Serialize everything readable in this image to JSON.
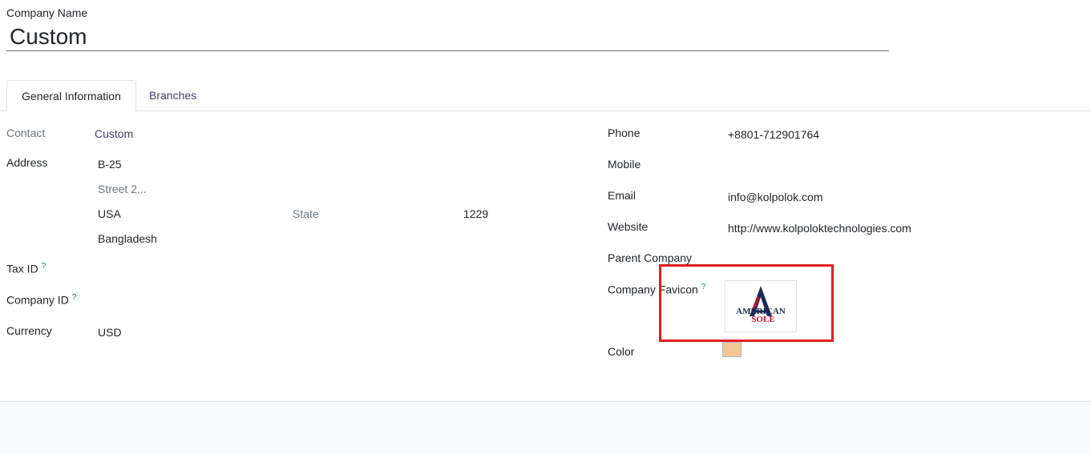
{
  "form": {
    "company_name_label": "Company Name",
    "company_name_value": "Custom"
  },
  "tabs": [
    {
      "label": "General Information",
      "active": true
    },
    {
      "label": "Branches",
      "active": false
    }
  ],
  "left": {
    "contact_label": "Contact",
    "contact_value": "Custom",
    "address_label": "Address",
    "street": "B-25",
    "street2_placeholder": "Street 2...",
    "city": "USA",
    "state_placeholder": "State",
    "zip": "1229",
    "country": "Bangladesh",
    "tax_id_label": "Tax ID",
    "company_id_label": "Company ID",
    "currency_label": "Currency",
    "currency_value": "USD",
    "help_mark": "?"
  },
  "right": {
    "phone_label": "Phone",
    "phone_value": "+8801-712901764",
    "mobile_label": "Mobile",
    "email_label": "Email",
    "email_value": "info@kolpolok.com",
    "website_label": "Website",
    "website_value": "http://www.kolpoloktechnologies.com",
    "parent_company_label": "Parent Company",
    "favicon_label": "Company Favicon",
    "favicon_logo_text_1": "AMERICAN",
    "favicon_logo_text_2": "SOLE",
    "color_label": "Color",
    "color_value": "#f2c796"
  },
  "colors": {
    "link": "#4a3a6a",
    "help": "#017e84",
    "highlight": "#e02020"
  }
}
